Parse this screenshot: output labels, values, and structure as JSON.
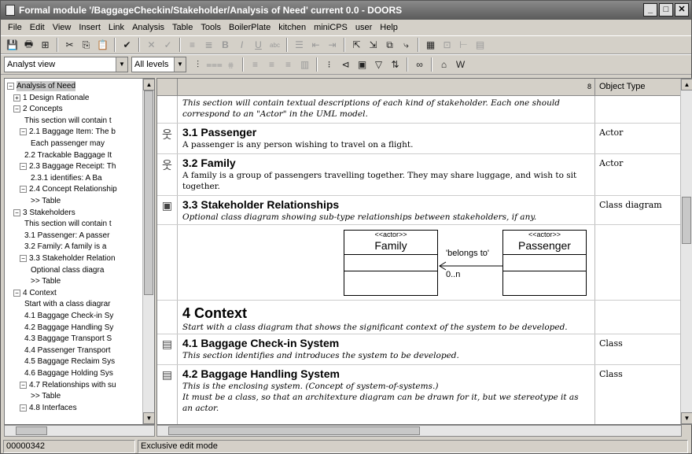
{
  "window": {
    "title": "Formal module '/BaggageCheckin/Stakeholder/Analysis of Need' current 0.0 - DOORS",
    "controls": {
      "minimize": "_",
      "maximize": "□",
      "close": "✕"
    }
  },
  "menu": [
    "File",
    "Edit",
    "View",
    "Insert",
    "Link",
    "Analysis",
    "Table",
    "Tools",
    "BoilerPlate",
    "kitchen",
    "miniCPS",
    "user",
    "Help"
  ],
  "toolbar": {
    "view_select": "Analyst view",
    "level_select": "All levels"
  },
  "tree": [
    {
      "label": "Analysis of Need",
      "expander": "−",
      "selected": true
    },
    {
      "label": "1 Design Rationale",
      "expander": "+"
    },
    {
      "label": "2 Concepts",
      "expander": "−"
    },
    {
      "label": "This section will contain t",
      "expander": ""
    },
    {
      "label": "2.1 Baggage Item: The b",
      "expander": "−"
    },
    {
      "label": "Each passenger may",
      "expander": ""
    },
    {
      "label": "2.2 Trackable Baggage It",
      "expander": ""
    },
    {
      "label": "2.3 Baggage Receipt: Th",
      "expander": "−"
    },
    {
      "label": "2.3.1 identifies: A Ba",
      "expander": ""
    },
    {
      "label": "2.4 Concept Relationship",
      "expander": "−"
    },
    {
      "label": ">> Table",
      "expander": ""
    },
    {
      "label": "3 Stakeholders",
      "expander": "−"
    },
    {
      "label": "This section will contain t",
      "expander": ""
    },
    {
      "label": "3.1 Passenger: A passer",
      "expander": ""
    },
    {
      "label": "3.2 Family: A family is a",
      "expander": ""
    },
    {
      "label": "3.3 Stakeholder Relation",
      "expander": "−"
    },
    {
      "label": "Optional class diagra",
      "expander": ""
    },
    {
      "label": ">> Table",
      "expander": ""
    },
    {
      "label": "4 Context",
      "expander": "−"
    },
    {
      "label": "Start with a class diagrar",
      "expander": ""
    },
    {
      "label": "4.1 Baggage Check-in Sy",
      "expander": ""
    },
    {
      "label": "4.2 Baggage Handling Sy",
      "expander": ""
    },
    {
      "label": "4.3 Baggage Transport S",
      "expander": ""
    },
    {
      "label": "4.4 Passenger Transport",
      "expander": ""
    },
    {
      "label": "4.5 Baggage Reclaim Sys",
      "expander": ""
    },
    {
      "label": "4.6 Baggage Holding Sys",
      "expander": ""
    },
    {
      "label": "4.7 Relationships with su",
      "expander": "−"
    },
    {
      "label": ">> Table",
      "expander": ""
    },
    {
      "label": "4.8 Interfaces",
      "expander": "−"
    }
  ],
  "grid": {
    "column_header": "Object Type",
    "main_header_mark": "8",
    "rows": [
      {
        "icon": "",
        "heading": "",
        "text": "This section will contain textual descriptions of each kind of stakeholder. Each one should correspond to an \"Actor\" in the UML model.",
        "type": ""
      },
      {
        "icon": "actor-icon",
        "heading": "3.1 Passenger",
        "text": "A passenger is any person wishing to travel on a flight.",
        "type": "Actor"
      },
      {
        "icon": "actor-icon",
        "heading": "3.2 Family",
        "text": "A family is a group of passengers travelling together. They may share luggage, and wish to sit together.",
        "type": "Actor"
      },
      {
        "icon": "class-diagram-icon",
        "heading": "3.3 Stakeholder Relationships",
        "text": "Optional class diagram showing sub-type relationships between stakeholders, if any.",
        "type": "Class diagram"
      },
      {
        "icon": "",
        "heading": "4 Context",
        "text": "Start with a class diagram that shows the significant context of the system to be developed.",
        "type": ""
      },
      {
        "icon": "class-icon",
        "heading": "4.1 Baggage Check-in System",
        "text": "This section identifies and introduces the system to be developed.",
        "type": "Class"
      },
      {
        "icon": "class-icon",
        "heading": "4.2 Baggage Handling System",
        "text": "This is the enclosing system. (Concept of system-of-systems.)",
        "text2": "It must be a class, so that an architexture diagram can be drawn for it, but we stereotype it as an actor.",
        "type": "Class"
      }
    ],
    "diagram": {
      "class1": {
        "stereotype": "<<actor>>",
        "name": "Family"
      },
      "class2": {
        "stereotype": "<<actor>>",
        "name": "Passenger"
      },
      "assoc_label": "'belongs to'",
      "assoc_mult": "0..n"
    }
  },
  "status": {
    "left": "00000342",
    "mode": "Exclusive edit mode"
  }
}
